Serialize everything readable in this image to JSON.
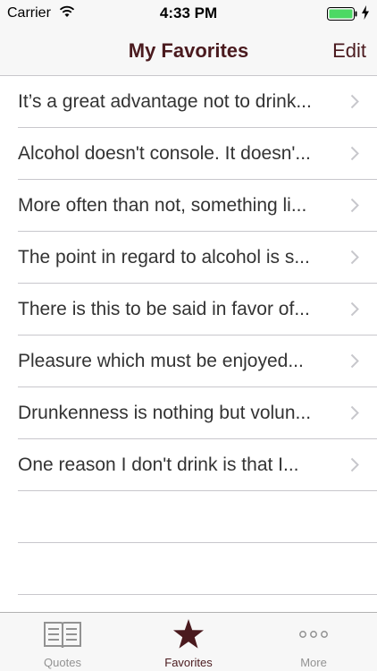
{
  "status_bar": {
    "carrier": "Carrier",
    "time": "4:33 PM",
    "battery_color": "#4cd964"
  },
  "nav": {
    "title": "My Favorites",
    "edit_label": "Edit",
    "accent_color": "#4a1a1e"
  },
  "favorites": [
    {
      "text": "It’s a great advantage not to drink..."
    },
    {
      "text": "Alcohol doesn't console. It doesn'..."
    },
    {
      "text": "More often than not, something li..."
    },
    {
      "text": "The point in regard to alcohol is s..."
    },
    {
      "text": "There is this to be said in favor of..."
    },
    {
      "text": "Pleasure which must be enjoyed..."
    },
    {
      "text": "Drunkenness is nothing but volun..."
    },
    {
      "text": "One reason I don't drink is that I..."
    }
  ],
  "tab_bar": {
    "tabs": [
      {
        "label": "Quotes",
        "icon": "book-icon",
        "selected": false
      },
      {
        "label": "Favorites",
        "icon": "star-icon",
        "selected": true
      },
      {
        "label": "More",
        "icon": "more-dots-icon",
        "selected": false
      }
    ]
  }
}
